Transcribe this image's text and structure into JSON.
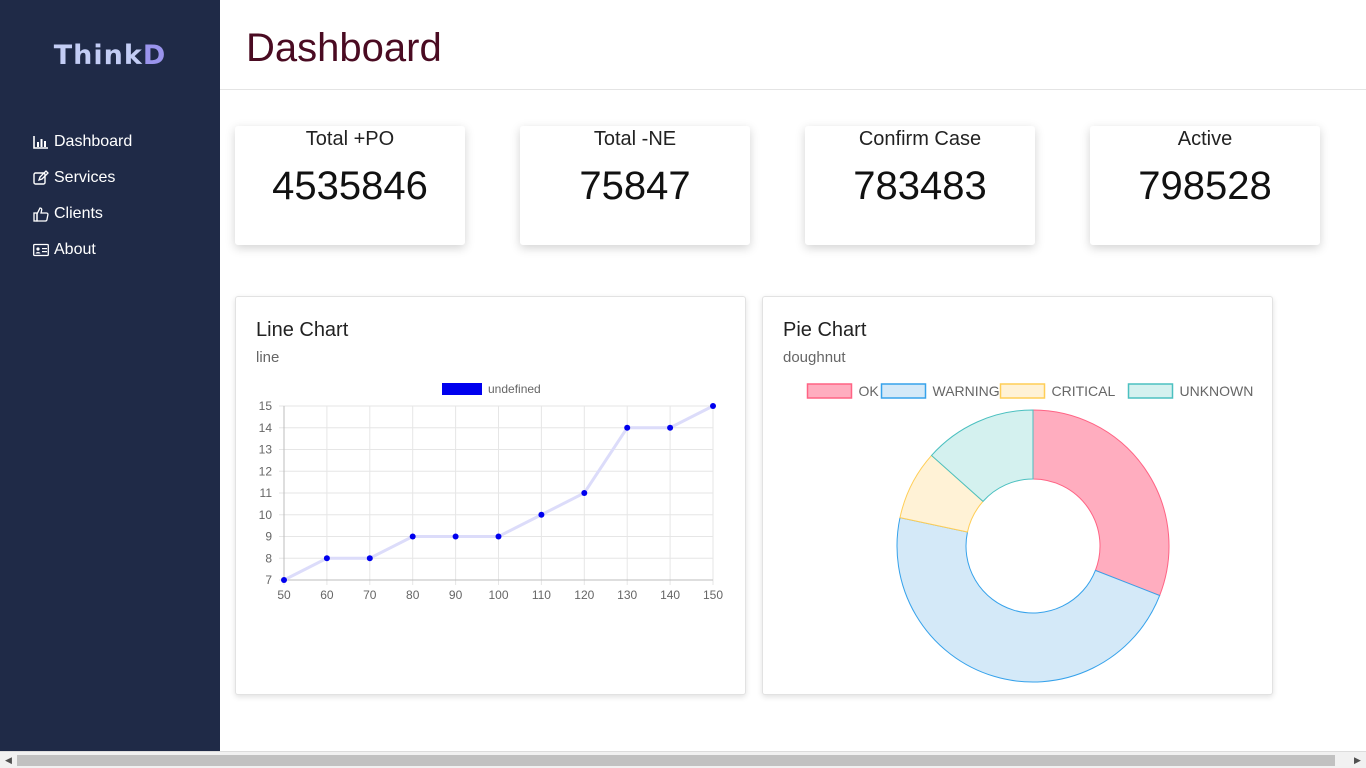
{
  "brand": {
    "name_main": "Think",
    "name_tail": "D"
  },
  "sidebar": {
    "items": [
      {
        "label": "Dashboard",
        "icon": "bar-chart-icon"
      },
      {
        "label": "Services",
        "icon": "edit-icon"
      },
      {
        "label": "Clients",
        "icon": "thumbs-up-icon"
      },
      {
        "label": "About",
        "icon": "id-card-icon"
      }
    ]
  },
  "header": {
    "title": "Dashboard"
  },
  "stats": [
    {
      "label": "Total +PO",
      "value": "4535846"
    },
    {
      "label": "Total -NE",
      "value": "75847"
    },
    {
      "label": "Confirm Case",
      "value": "783483"
    },
    {
      "label": "Active",
      "value": "798528"
    }
  ],
  "cards": {
    "line": {
      "title": "Line Chart",
      "subtitle": "line"
    },
    "pie": {
      "title": "Pie Chart",
      "subtitle": "doughnut"
    }
  },
  "colors": {
    "sidebar_bg": "#1f2a47",
    "title": "#4a0b22",
    "line_point": "#0000ee",
    "line_stroke": "#dcdcfa"
  },
  "chart_data": [
    {
      "type": "line",
      "legend": [
        "undefined"
      ],
      "x": [
        50,
        60,
        70,
        80,
        90,
        100,
        110,
        120,
        130,
        140,
        150
      ],
      "series": [
        {
          "name": "undefined",
          "values": [
            7,
            8,
            8,
            9,
            9,
            9,
            10,
            11,
            14,
            14,
            15
          ]
        }
      ],
      "xlim": [
        50,
        150
      ],
      "ylim": [
        7,
        15
      ],
      "x_ticks": [
        "50",
        "60",
        "70",
        "80",
        "90",
        "100",
        "110",
        "120",
        "130",
        "140",
        "150"
      ],
      "y_ticks": [
        "7",
        "8",
        "9",
        "10",
        "11",
        "12",
        "13",
        "14",
        "15"
      ],
      "grid": true,
      "legend_position": "top"
    },
    {
      "type": "pie",
      "variant": "doughnut",
      "categories": [
        "OK",
        "WARNING",
        "CRITICAL",
        "UNKNOWN"
      ],
      "values": [
        30,
        46,
        8,
        13
      ],
      "colors": [
        "#ffadbf",
        "#d4e9f8",
        "#fff2d6",
        "#d4f1ef"
      ],
      "borders": [
        "#ff6384",
        "#36a2eb",
        "#ffce56",
        "#4bc0c0"
      ],
      "legend_position": "top"
    }
  ]
}
